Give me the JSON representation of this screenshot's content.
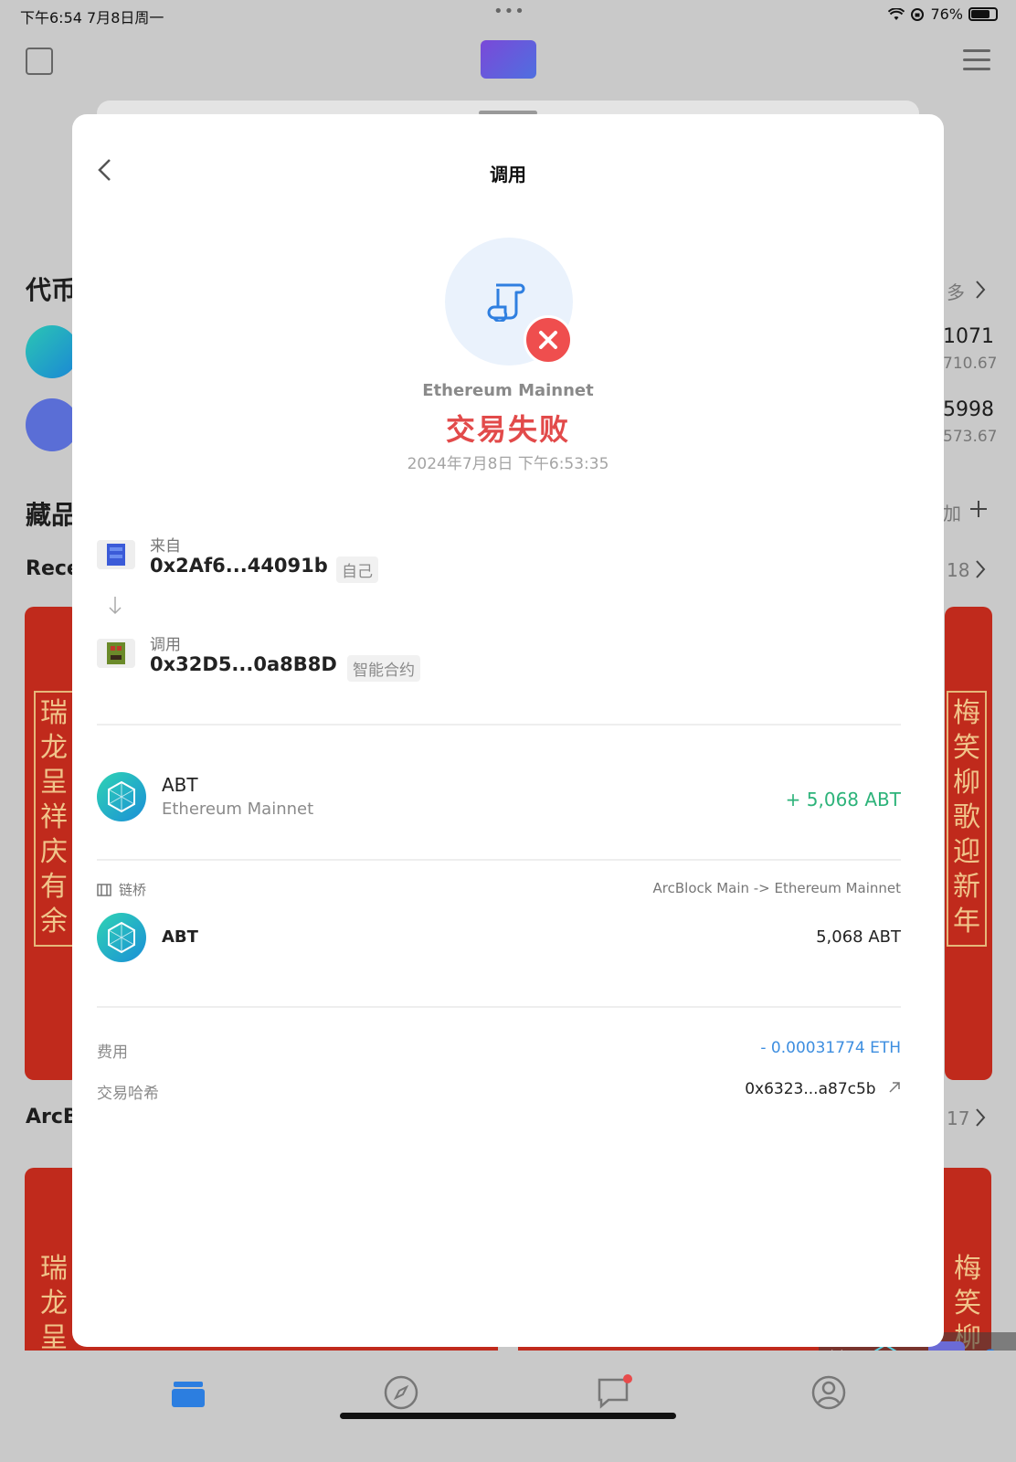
{
  "status_bar": {
    "time": "下午6:54   7月8日周一",
    "dots": "•••",
    "battery": "76%",
    "battery_level": 0.76
  },
  "background": {
    "section_tokens": "代币",
    "more_label": "多",
    "token1_value": "1071",
    "token1_fiat": "710.67",
    "token2_value": "5998",
    "token2_fiat": "573.67",
    "section_collectibles": "藏品",
    "add_label": "加",
    "recent_label": "Rece",
    "recent_count": "18",
    "arc_label": "ArcB",
    "arc_count": "17",
    "card_left_text": "瑞龙呈祥庆有余",
    "card_right_text": "梅笑柳歌迎新年",
    "card_left_text_short": "瑞龙呈",
    "card_right_text_short": "梅笑柳"
  },
  "modal": {
    "title": "调用",
    "network": "Ethereum Mainnet",
    "status": "交易失败",
    "datetime": "2024年7月8日 下午6:53:35",
    "from": {
      "label": "来自",
      "address": "0x2Af6...44091b",
      "tag": "自己"
    },
    "to": {
      "label": "调用",
      "address": "0x32D5...0a8B8D",
      "tag": "智能合约"
    },
    "token": {
      "name": "ABT",
      "network": "Ethereum Mainnet",
      "amount": "+ 5,068 ABT"
    },
    "bridge": {
      "label": "链桥",
      "route": "ArcBlock Main -> Ethereum Mainnet",
      "token": "ABT",
      "amount": "5,068 ABT"
    },
    "fee": {
      "label": "费用",
      "value": "- 0.00031774 ETH"
    },
    "hash": {
      "label": "交易哈希",
      "value": "0x6323...a87c5b"
    }
  },
  "colors": {
    "fail_red": "#e24a4a",
    "positive_green": "#2db37a",
    "fee_blue": "#3d8ee0"
  }
}
